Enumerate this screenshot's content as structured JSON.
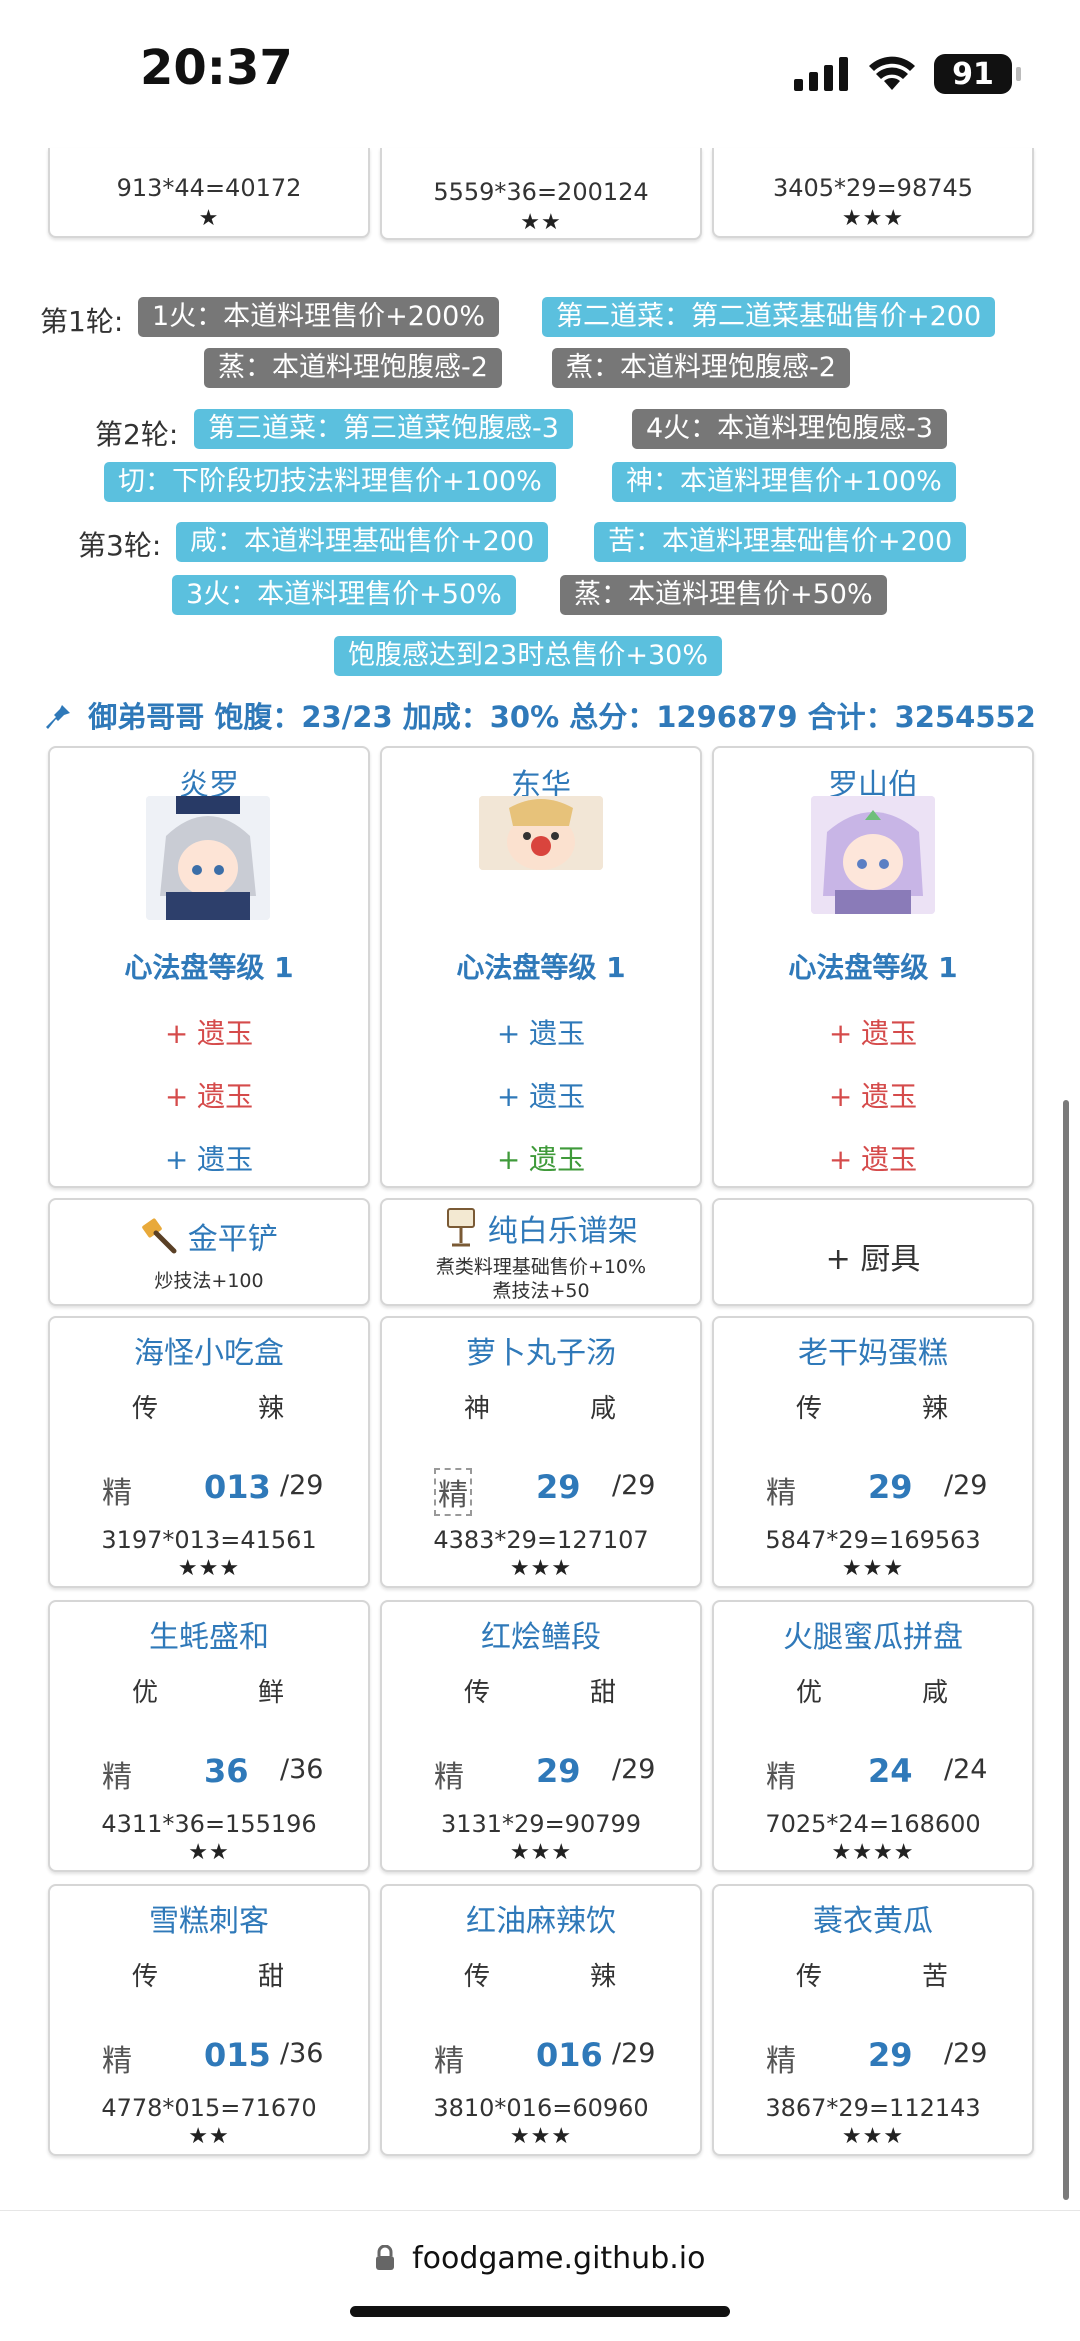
{
  "status": {
    "time": "20:37",
    "battery": "91"
  },
  "top_cards": [
    {
      "formula": "913*44=40172",
      "stars": "★"
    },
    {
      "formula": "5559*36=200124",
      "stars": "★★"
    },
    {
      "formula": "3405*29=98745",
      "stars": "★★★"
    }
  ],
  "rules": {
    "round1": "第1轮:",
    "round2": "第2轮:",
    "round3": "第3轮:",
    "r1_tag1": "1火：本道料理售价+200%",
    "r1_tag2": "第二道菜：第二道菜基础售价+200",
    "r1_tag3": "蒸：本道料理饱腹感-2",
    "r1_tag4": "煮：本道料理饱腹感-2",
    "r2_tag1": "第三道菜：第三道菜饱腹感-3",
    "r2_tag2": "4火：本道料理饱腹感-3",
    "r2_tag3": "切：下阶段切技法料理售价+100%",
    "r2_tag4": "神：本道料理售价+100%",
    "r3_tag1": "咸：本道料理基础售价+200",
    "r3_tag2": "苦：本道料理基础售价+200",
    "r3_tag3": "3火：本道料理售价+50%",
    "r3_tag4": "蒸：本道料理售价+50%",
    "bonus": "饱腹感达到23时总售价+30%"
  },
  "summary": "御弟哥哥 饱腹：23/23 加成：30% 总分：1296879 合计：3254552",
  "chefs": [
    {
      "name": "炎罗",
      "level": "心法盘等级 1",
      "jade": [
        "+ 遗玉",
        "+ 遗玉",
        "+ 遗玉"
      ],
      "jade_colors": [
        "#d54b4b",
        "#d54b4b",
        "#2f79b9"
      ]
    },
    {
      "name": "东华",
      "level": "心法盘等级 1",
      "jade": [
        "+ 遗玉",
        "+ 遗玉",
        "+ 遗玉"
      ],
      "jade_colors": [
        "#2f79b9",
        "#2f79b9",
        "#3f9a3a"
      ]
    },
    {
      "name": "罗山伯",
      "level": "心法盘等级 1",
      "jade": [
        "+ 遗玉",
        "+ 遗玉",
        "+ 遗玉"
      ],
      "jade_colors": [
        "#d54b4b",
        "#d54b4b",
        "#d54b4b"
      ]
    }
  ],
  "equip": [
    {
      "name": "金平铲",
      "desc1": "炒技法+100",
      "desc2": ""
    },
    {
      "name": "纯白乐谱架",
      "desc1": "煮类料理基础售价+10%",
      "desc2": "煮技法+50"
    },
    {
      "name": "+ 厨具",
      "desc1": "",
      "desc2": ""
    }
  ],
  "dishes": [
    {
      "name": "海怪小吃盒",
      "skill1": "传",
      "skill2": "辣",
      "grade": "精",
      "qty": "013",
      "limit": "/29",
      "formula": "3197*013=41561",
      "stars": "★★★"
    },
    {
      "name": "萝卜丸子汤",
      "skill1": "神",
      "skill2": "咸",
      "grade": "精",
      "qty": "29",
      "limit": "/29",
      "formula": "4383*29=127107",
      "stars": "★★★"
    },
    {
      "name": "老干妈蛋糕",
      "skill1": "传",
      "skill2": "辣",
      "grade": "精",
      "qty": "29",
      "limit": "/29",
      "formula": "5847*29=169563",
      "stars": "★★★"
    },
    {
      "name": "生蚝盛和",
      "skill1": "优",
      "skill2": "鲜",
      "grade": "精",
      "qty": "36",
      "limit": "/36",
      "formula": "4311*36=155196",
      "stars": "★★"
    },
    {
      "name": "红烩鳝段",
      "skill1": "传",
      "skill2": "甜",
      "grade": "精",
      "qty": "29",
      "limit": "/29",
      "formula": "3131*29=90799",
      "stars": "★★★"
    },
    {
      "name": "火腿蜜瓜拼盘",
      "skill1": "优",
      "skill2": "咸",
      "grade": "精",
      "qty": "24",
      "limit": "/24",
      "formula": "7025*24=168600",
      "stars": "★★★★"
    },
    {
      "name": "雪糕刺客",
      "skill1": "传",
      "skill2": "甜",
      "grade": "精",
      "qty": "015",
      "limit": "/36",
      "formula": "4778*015=71670",
      "stars": "★★"
    },
    {
      "name": "红油麻辣饮",
      "skill1": "传",
      "skill2": "辣",
      "grade": "精",
      "qty": "016",
      "limit": "/29",
      "formula": "3810*016=60960",
      "stars": "★★★"
    },
    {
      "name": "蓑衣黄瓜",
      "skill1": "传",
      "skill2": "苦",
      "grade": "精",
      "qty": "29",
      "limit": "/29",
      "formula": "3867*29=112143",
      "stars": "★★★"
    }
  ],
  "browser": {
    "url": "foodgame.github.io"
  },
  "colors": {
    "accent_blue": "#2f79b9",
    "tag_blue": "#5bc0de",
    "tag_gray": "#777777"
  }
}
